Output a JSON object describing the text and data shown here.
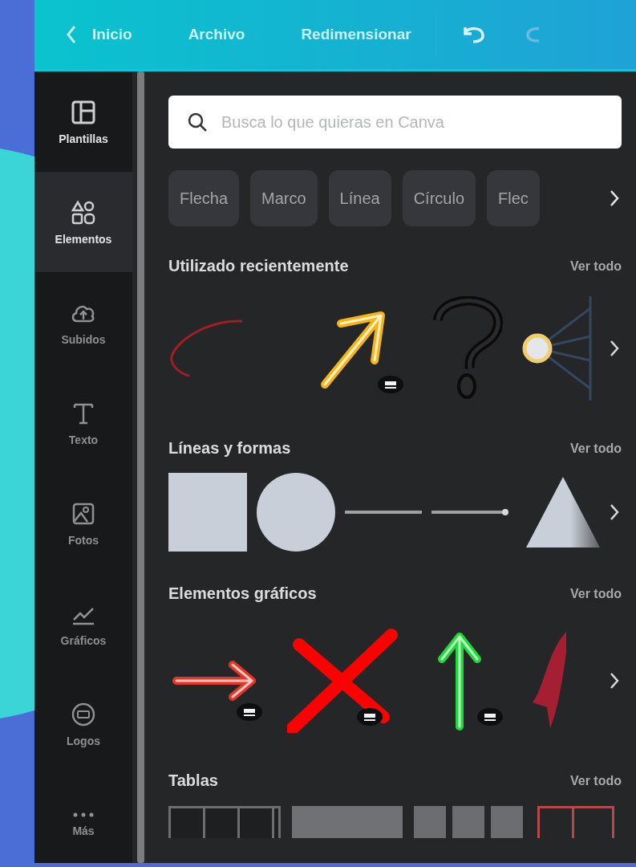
{
  "topbar": {
    "back_label": "Inicio",
    "menu": [
      {
        "label": "Archivo"
      },
      {
        "label": "Redimensionar"
      }
    ]
  },
  "sidebar": {
    "items": [
      {
        "kind": "templates",
        "label": "Plantillas",
        "selected": false
      },
      {
        "kind": "elements",
        "label": "Elementos",
        "selected": true
      },
      {
        "kind": "uploads",
        "label": "Subidos",
        "selected": false
      },
      {
        "kind": "text",
        "label": "Texto",
        "selected": false
      },
      {
        "kind": "photos",
        "label": "Fotos",
        "selected": false
      },
      {
        "kind": "charts",
        "label": "Gráficos",
        "selected": false
      },
      {
        "kind": "logos",
        "label": "Logos",
        "selected": false
      },
      {
        "kind": "more",
        "label": "Más",
        "selected": false
      }
    ]
  },
  "search": {
    "placeholder": "Busca lo que quieras en Canva"
  },
  "chips": [
    {
      "label": "Flecha"
    },
    {
      "label": "Marco"
    },
    {
      "label": "Línea"
    },
    {
      "label": "Círculo"
    },
    {
      "label": "Flec"
    }
  ],
  "sections": [
    {
      "kind": "recent",
      "title": "Utilizado recientemente",
      "link": "Ver todo",
      "items": [
        {
          "kind": "curve",
          "premium": false
        },
        {
          "kind": "neon-arrow",
          "premium": true
        },
        {
          "kind": "question",
          "premium": false
        },
        {
          "kind": "network",
          "premium": false
        }
      ]
    },
    {
      "kind": "shapes",
      "title": "Líneas y formas",
      "link": "Ver todo",
      "items": [
        {
          "kind": "square",
          "premium": false
        },
        {
          "kind": "circle",
          "premium": false
        },
        {
          "kind": "line",
          "premium": false
        },
        {
          "kind": "arrow-line",
          "premium": false
        },
        {
          "kind": "triangle",
          "premium": false
        }
      ]
    },
    {
      "kind": "graphics",
      "title": "Elementos gráficos",
      "link": "Ver todo",
      "items": [
        {
          "kind": "neon-right",
          "premium": true
        },
        {
          "kind": "cross",
          "premium": true
        },
        {
          "kind": "green-up",
          "premium": true
        },
        {
          "kind": "brush",
          "premium": false
        }
      ]
    },
    {
      "kind": "tables",
      "title": "Tablas",
      "link": "Ver todo",
      "items": [
        {
          "kind": "table-grid",
          "premium": false
        },
        {
          "kind": "table-header",
          "premium": false
        },
        {
          "kind": "table-columns",
          "premium": false
        },
        {
          "kind": "table-red",
          "premium": false
        }
      ]
    }
  ]
}
